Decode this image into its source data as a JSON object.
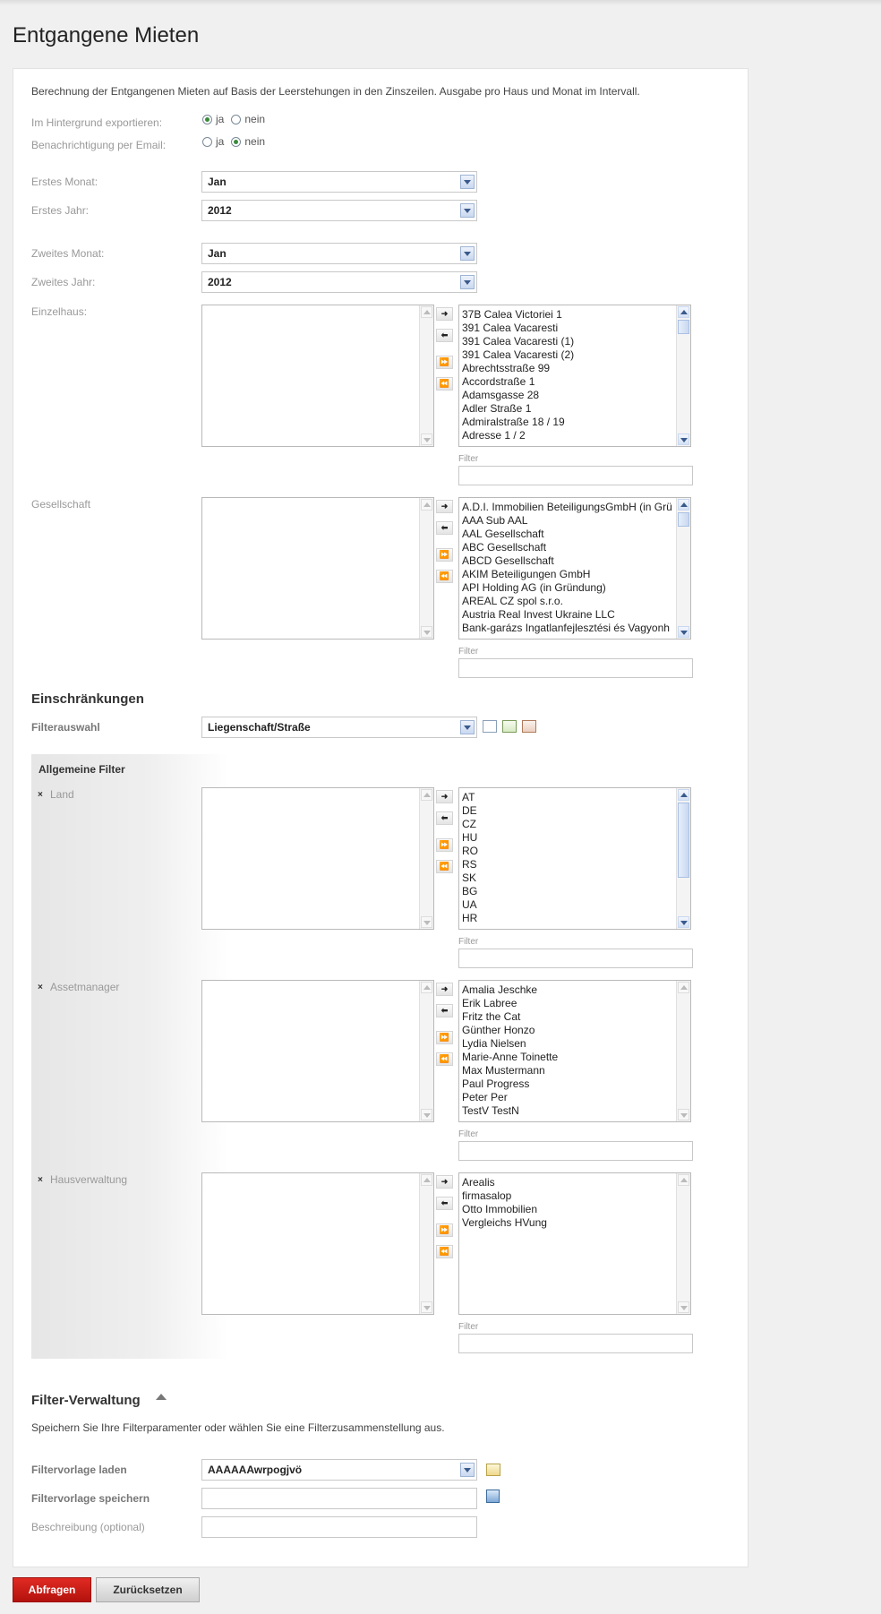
{
  "title": "Entgangene Mieten",
  "description": "Berechnung der Entgangenen Mieten auf Basis der Leerstehungen in den Zinszeilen. Ausgabe pro Haus und Monat im Intervall.",
  "export_bg": {
    "label": "Im Hintergrund exportieren:",
    "yes": "ja",
    "no": "nein",
    "selected": "ja"
  },
  "email_notify": {
    "label": "Benachrichtigung per Email:",
    "yes": "ja",
    "no": "nein",
    "selected": "nein"
  },
  "first_month": {
    "label": "Erstes Monat:",
    "value": "Jan"
  },
  "first_year": {
    "label": "Erstes Jahr:",
    "value": "2012"
  },
  "second_month": {
    "label": "Zweites Monat:",
    "value": "Jan"
  },
  "second_year": {
    "label": "Zweites Jahr:",
    "value": "2012"
  },
  "move_buttons": {
    "add": "➜",
    "remove": "⬅",
    "add_all": "⏩",
    "remove_all": "⏪"
  },
  "filter_label": "Filter",
  "einzelhaus": {
    "label": "Einzelhaus:",
    "available": [
      "37B Calea Victoriei 1",
      "391 Calea Vacaresti",
      "391 Calea Vacaresti (1)",
      "391 Calea Vacaresti (2)",
      "Abrechtsstraße 99",
      "Accordstraße 1",
      "Adamsgasse 28",
      "Adler Straße 1",
      "Admiralstraße 18 / 19",
      "Adresse 1 / 2"
    ]
  },
  "gesellschaft": {
    "label": "Gesellschaft",
    "available": [
      "A.D.I. Immobilien BeteiligungsGmbH (in Grü",
      "AAA Sub AAL",
      "AAL Gesellschaft",
      "ABC Gesellschaft",
      "ABCD Gesellschaft",
      "AKIM Beteiligungen GmbH",
      "API Holding AG (in Gründung)",
      "AREAL CZ spol s.r.o.",
      "Austria Real Invest Ukraine LLC",
      "Bank-garázs Ingatlanfejlesztési és Vagyonh"
    ]
  },
  "restrictions": {
    "heading": "Einschränkungen",
    "filter_select_label": "Filterauswahl",
    "filter_select_value": "Liegenschaft/Straße",
    "general_filters": "Allgemeine Filter",
    "remove_icon": "×"
  },
  "land": {
    "label": "Land",
    "available": [
      "AT",
      "DE",
      "CZ",
      "HU",
      "RO",
      "RS",
      "SK",
      "BG",
      "UA",
      "HR"
    ]
  },
  "assetmanager": {
    "label": "Assetmanager",
    "available": [
      "Amalia Jeschke",
      "Erik Labree",
      "Fritz the Cat",
      "Günther Honzo",
      "Lydia Nielsen",
      "Marie-Anne Toinette",
      "Max Mustermann",
      "Paul Progress",
      "Peter Per",
      "TestV TestN"
    ]
  },
  "hausverwaltung": {
    "label": "Hausverwaltung",
    "available": [
      "Arealis",
      "firmasalop",
      "Otto Immobilien",
      "Vergleichs HVung"
    ]
  },
  "filter_mgmt": {
    "heading": "Filter-Verwaltung",
    "description": "Speichern Sie Ihre Filterparamenter oder wählen Sie eine Filterzusammenstellung aus.",
    "load_label": "Filtervorlage laden",
    "load_value": "AAAAAAwrpogjvö",
    "save_label": "Filtervorlage speichern",
    "description_label": "Beschreibung (optional)"
  },
  "buttons": {
    "submit": "Abfragen",
    "reset": "Zurücksetzen"
  }
}
